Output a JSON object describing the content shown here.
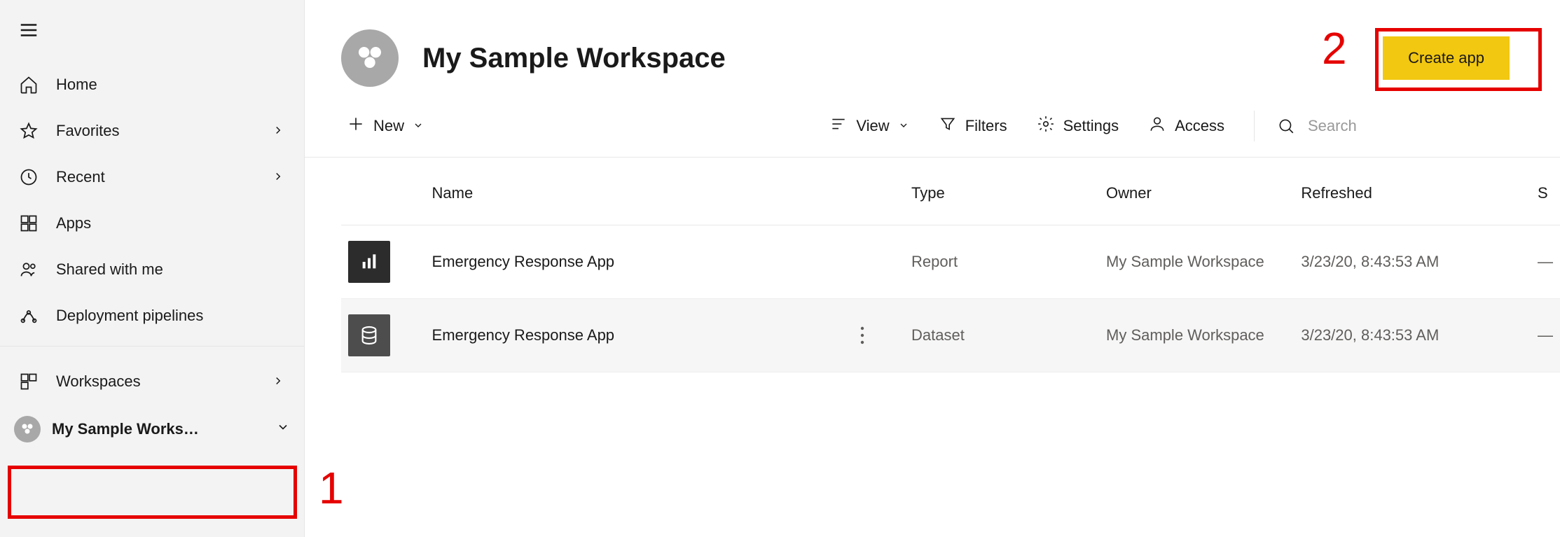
{
  "sidebar": {
    "items": [
      {
        "label": "Home",
        "icon": "home-icon",
        "hasChevron": false
      },
      {
        "label": "Favorites",
        "icon": "star-icon",
        "hasChevron": true
      },
      {
        "label": "Recent",
        "icon": "clock-icon",
        "hasChevron": true
      },
      {
        "label": "Apps",
        "icon": "apps-icon",
        "hasChevron": false
      },
      {
        "label": "Shared with me",
        "icon": "shared-icon",
        "hasChevron": false
      },
      {
        "label": "Deployment pipelines",
        "icon": "pipeline-icon",
        "hasChevron": false
      }
    ],
    "workspaces_label": "Workspaces",
    "current_workspace": "My Sample Works…"
  },
  "header": {
    "title": "My Sample Workspace",
    "create_app_label": "Create app"
  },
  "toolbar": {
    "new_label": "New",
    "view_label": "View",
    "filters_label": "Filters",
    "settings_label": "Settings",
    "access_label": "Access",
    "search_placeholder": "Search"
  },
  "table": {
    "columns": {
      "name": "Name",
      "type": "Type",
      "owner": "Owner",
      "refreshed": "Refreshed",
      "extra": "S"
    },
    "rows": [
      {
        "icon": "report",
        "name": "Emergency Response App",
        "type": "Report",
        "owner": "My Sample Workspace",
        "refreshed": "3/23/20, 8:43:53 AM",
        "extra": "—",
        "hovered": false,
        "showMore": false
      },
      {
        "icon": "dataset",
        "name": "Emergency Response App",
        "type": "Dataset",
        "owner": "My Sample Workspace",
        "refreshed": "3/23/20, 8:43:53 AM",
        "extra": "—",
        "hovered": true,
        "showMore": true
      }
    ]
  },
  "annotations": {
    "one": "1",
    "two": "2"
  }
}
